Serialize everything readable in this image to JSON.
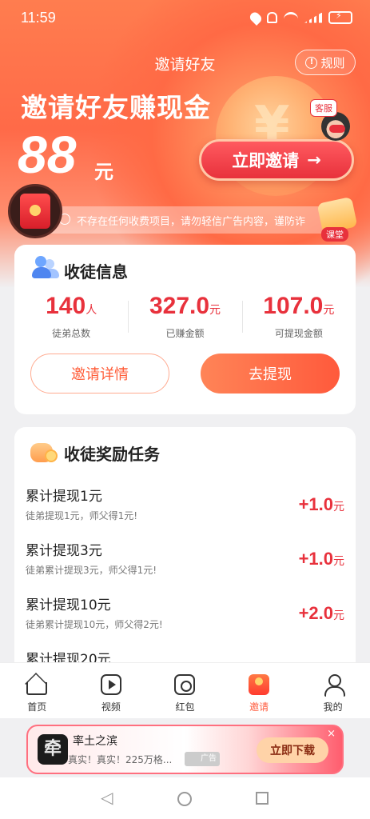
{
  "status_bar": {
    "time": "11:59"
  },
  "header": {
    "title": "邀请好友",
    "rules_label": "规则"
  },
  "hero": {
    "headline": "邀请好友赚现金",
    "amount": "88",
    "amount_unit": "元",
    "invite_button": "立即邀请",
    "invite_arrow": "→",
    "service_label": "客服",
    "course_label": "课堂",
    "notice": "不存在任何收费项目，请勿轻信广告内容，谨防诈"
  },
  "apprentice_info": {
    "title": "收徒信息",
    "stats": [
      {
        "value": "140",
        "unit": "人",
        "label": "徒弟总数"
      },
      {
        "value": "327.0",
        "unit": "元",
        "label": "已赚金额"
      },
      {
        "value": "107.0",
        "unit": "元",
        "label": "可提现金额"
      }
    ],
    "details_button": "邀请详情",
    "withdraw_button": "去提现"
  },
  "reward_tasks": {
    "title": "收徒奖励任务",
    "items": [
      {
        "name": "累计提现1元",
        "desc": "徒弟提现1元，师父得1元!",
        "reward": "+1.0",
        "unit": "元"
      },
      {
        "name": "累计提现3元",
        "desc": "徒弟累计提现3元，师父得1元!",
        "reward": "+1.0",
        "unit": "元"
      },
      {
        "name": "累计提现10元",
        "desc": "徒弟累计提现10元，师父得2元!",
        "reward": "+2.0",
        "unit": "元"
      },
      {
        "name": "累计提现20元",
        "desc": "",
        "reward": "",
        "unit": ""
      }
    ]
  },
  "tabs": [
    {
      "label": "首页",
      "icon": "home-icon"
    },
    {
      "label": "视频",
      "icon": "video-icon"
    },
    {
      "label": "红包",
      "icon": "red-packet-icon"
    },
    {
      "label": "邀请",
      "icon": "invite-icon",
      "active": true
    },
    {
      "label": "我的",
      "icon": "profile-icon"
    }
  ],
  "ad": {
    "logo_char": "牵",
    "title": "率土之滨",
    "subtitle": "真实！真实！225万格...",
    "tag": "广告",
    "download_button": "立即下载",
    "close": "×"
  },
  "colors": {
    "accent": "#ff5a3c",
    "reward_red": "#e8313c"
  }
}
